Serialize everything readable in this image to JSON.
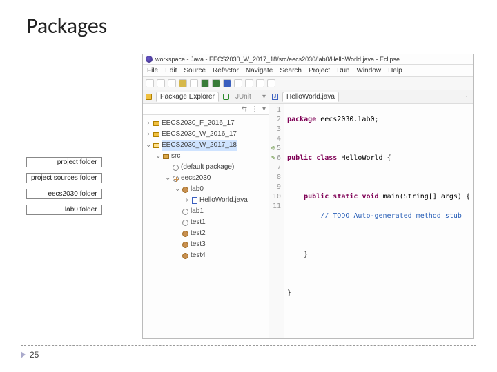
{
  "slide": {
    "title": "Packages",
    "page": "25"
  },
  "callouts": {
    "project": "project folder",
    "src": "project sources folder",
    "eecs": "eecs2030 folder",
    "lab0": "lab0 folder"
  },
  "eclipse": {
    "title": "workspace - Java - EECS2030_W_2017_18/src/eecs2030/lab0/HelloWorld.java - Eclipse",
    "menus": [
      "File",
      "Edit",
      "Source",
      "Refactor",
      "Navigate",
      "Search",
      "Project",
      "Run",
      "Window",
      "Help"
    ],
    "left_tabs": {
      "active": "Package Explorer",
      "inactive": "JUnit"
    },
    "editor_tab": "HelloWorld.java",
    "tree": {
      "p1": "EECS2030_F_2016_17",
      "p2": "EECS2030_W_2016_17",
      "p3": "EECS2030_W_2017_18",
      "src": "src",
      "default_pkg": "(default package)",
      "eecs": "eecs2030",
      "lab0": "lab0",
      "hw": "HelloWorld.java",
      "lab1": "lab1",
      "test1": "test1",
      "test2": "test2",
      "test3": "test3",
      "test4": "test4"
    },
    "code": {
      "l1_kw": "package",
      "l1_rest": " eecs2030.lab0;",
      "l3_kw1": "public",
      "l3_kw2": "class",
      "l3_cls": "HelloWorld",
      "l3_brace": " {",
      "l5_kw1": "public",
      "l5_kw2": "static",
      "l5_kw3": "void",
      "l5_rest": " main(String[] args) {",
      "l6_todo": "// TODO Auto-generated method stub",
      "l8_brace": "}",
      "l10_brace": "}",
      "gutter": {
        "n1": "1",
        "n2": "2",
        "n3": "3",
        "n4": "4",
        "n5": "5",
        "n6": "6",
        "n7": "7",
        "n8": "8",
        "n9": "9",
        "n10": "10",
        "n11": "11"
      }
    }
  }
}
